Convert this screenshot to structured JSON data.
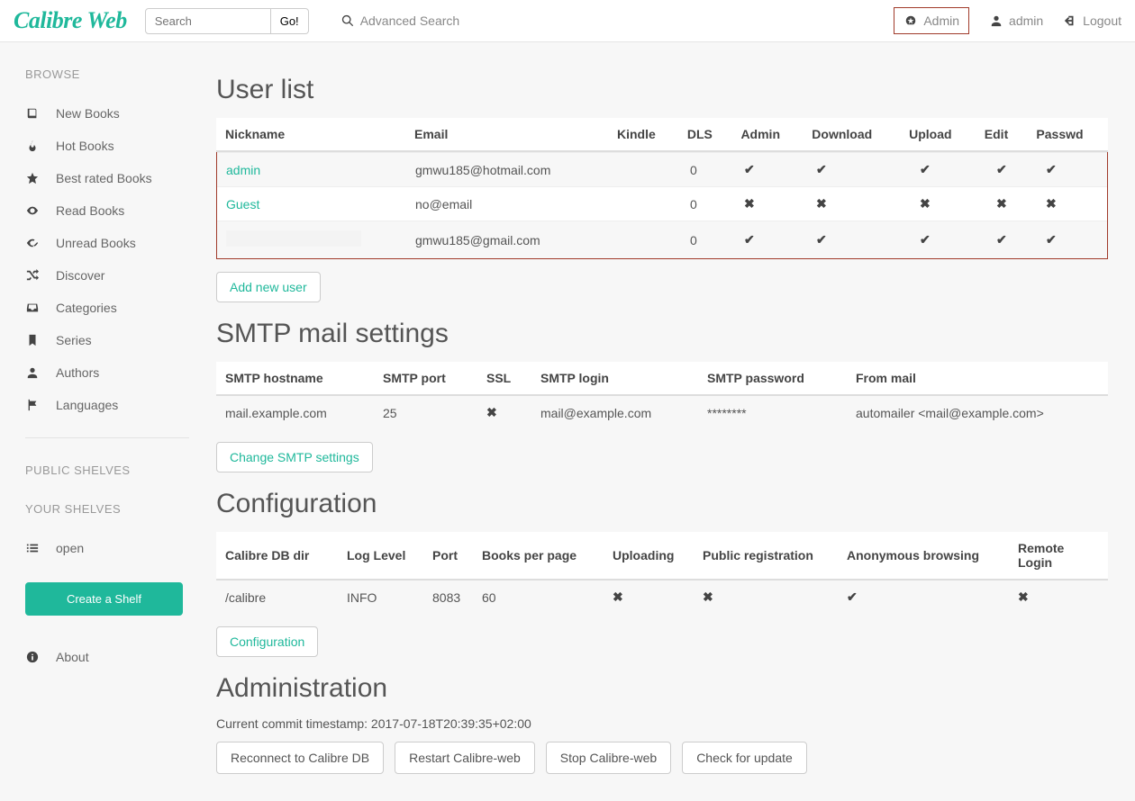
{
  "brand": "Calibre Web",
  "search": {
    "placeholder": "Search",
    "go": "Go!",
    "advanced": "Advanced Search"
  },
  "nav": {
    "admin": "Admin",
    "user": "admin",
    "logout": "Logout"
  },
  "sidebar": {
    "browse_title": "BROWSE",
    "items": [
      {
        "label": "New Books"
      },
      {
        "label": "Hot Books"
      },
      {
        "label": "Best rated Books"
      },
      {
        "label": "Read Books"
      },
      {
        "label": "Unread Books"
      },
      {
        "label": "Discover"
      },
      {
        "label": "Categories"
      },
      {
        "label": "Series"
      },
      {
        "label": "Authors"
      },
      {
        "label": "Languages"
      }
    ],
    "public_shelves_title": "PUBLIC SHELVES",
    "your_shelves_title": "YOUR SHELVES",
    "open_label": "open",
    "create_shelf": "Create a Shelf",
    "about": "About"
  },
  "userlist": {
    "title": "User list",
    "headers": {
      "nickname": "Nickname",
      "email": "Email",
      "kindle": "Kindle",
      "dls": "DLS",
      "admin": "Admin",
      "download": "Download",
      "upload": "Upload",
      "edit": "Edit",
      "passwd": "Passwd"
    },
    "rows": [
      {
        "nickname": "admin",
        "email": "gmwu185@hotmail.com",
        "kindle": "",
        "dls": "0",
        "admin": true,
        "download": true,
        "upload": true,
        "edit": true,
        "passwd": true
      },
      {
        "nickname": "Guest",
        "email": "no@email",
        "kindle": "",
        "dls": "0",
        "admin": false,
        "download": false,
        "upload": false,
        "edit": false,
        "passwd": false
      },
      {
        "nickname": "",
        "email": "gmwu185@gmail.com",
        "kindle": "",
        "dls": "0",
        "admin": true,
        "download": true,
        "upload": true,
        "edit": true,
        "passwd": true
      }
    ],
    "add_btn": "Add new user"
  },
  "smtp": {
    "title": "SMTP mail settings",
    "headers": {
      "hostname": "SMTP hostname",
      "port": "SMTP port",
      "ssl": "SSL",
      "login": "SMTP login",
      "password": "SMTP password",
      "from": "From mail"
    },
    "row": {
      "hostname": "mail.example.com",
      "port": "25",
      "ssl": false,
      "login": "mail@example.com",
      "password": "********",
      "from": "automailer <mail@example.com>"
    },
    "change_btn": "Change SMTP settings"
  },
  "config": {
    "title": "Configuration",
    "headers": {
      "dbdir": "Calibre DB dir",
      "loglevel": "Log Level",
      "port": "Port",
      "bpp": "Books per page",
      "uploading": "Uploading",
      "pubreg": "Public registration",
      "anon": "Anonymous browsing",
      "remote": "Remote Login"
    },
    "row": {
      "dbdir": "/calibre",
      "loglevel": "INFO",
      "port": "8083",
      "bpp": "60",
      "uploading": false,
      "pubreg": false,
      "anon": true,
      "remote": false
    },
    "btn": "Configuration"
  },
  "admin": {
    "title": "Administration",
    "timestamp": "Current commit timestamp: 2017-07-18T20:39:35+02:00",
    "reconnect": "Reconnect to Calibre DB",
    "restart": "Restart Calibre-web",
    "stop": "Stop Calibre-web",
    "check": "Check for update"
  }
}
